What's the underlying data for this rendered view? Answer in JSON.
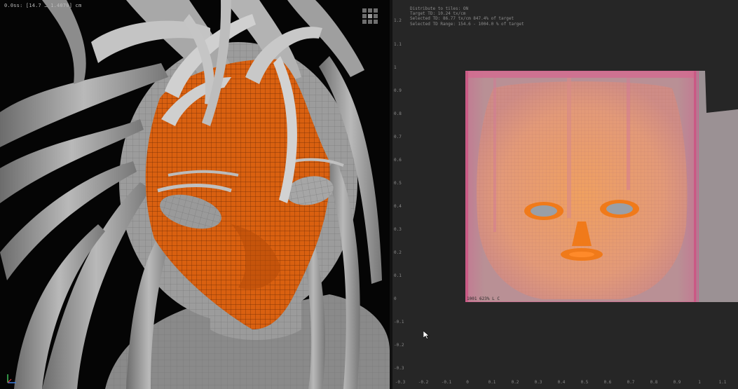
{
  "viewport": {
    "hud_text": "0.0ss: [14.7 … 1.4070] cm"
  },
  "uv_editor": {
    "info_lines": [
      "Distribute to tiles: ON",
      "Target TD: 10.24 tx/cm",
      "Selected TD: 86.77 tx/cm 847.4% of target",
      "Selected TD Range: 154.6 - 1004.0 % of target"
    ],
    "tile_label": "1001   623%  L   C",
    "y_ticks": [
      "1.2",
      "1.1",
      "1",
      "0.9",
      "0.8",
      "0.7",
      "0.6",
      "0.5",
      "0.4",
      "0.3",
      "0.2",
      "0.1",
      "0",
      "-0.1",
      "-0.2",
      "-0.3"
    ],
    "x_ticks": [
      "-0.3",
      "-0.2",
      "-0.1",
      "0",
      "0.1",
      "0.2",
      "0.3",
      "0.4",
      "0.5",
      "0.6",
      "0.7",
      "0.8",
      "0.9",
      "1",
      "1.1"
    ]
  },
  "colors": {
    "uv_selected": "#f07a1a",
    "mesh_gray": "#8e8e8e",
    "face_orange": "#d96010",
    "background": "#262626"
  }
}
